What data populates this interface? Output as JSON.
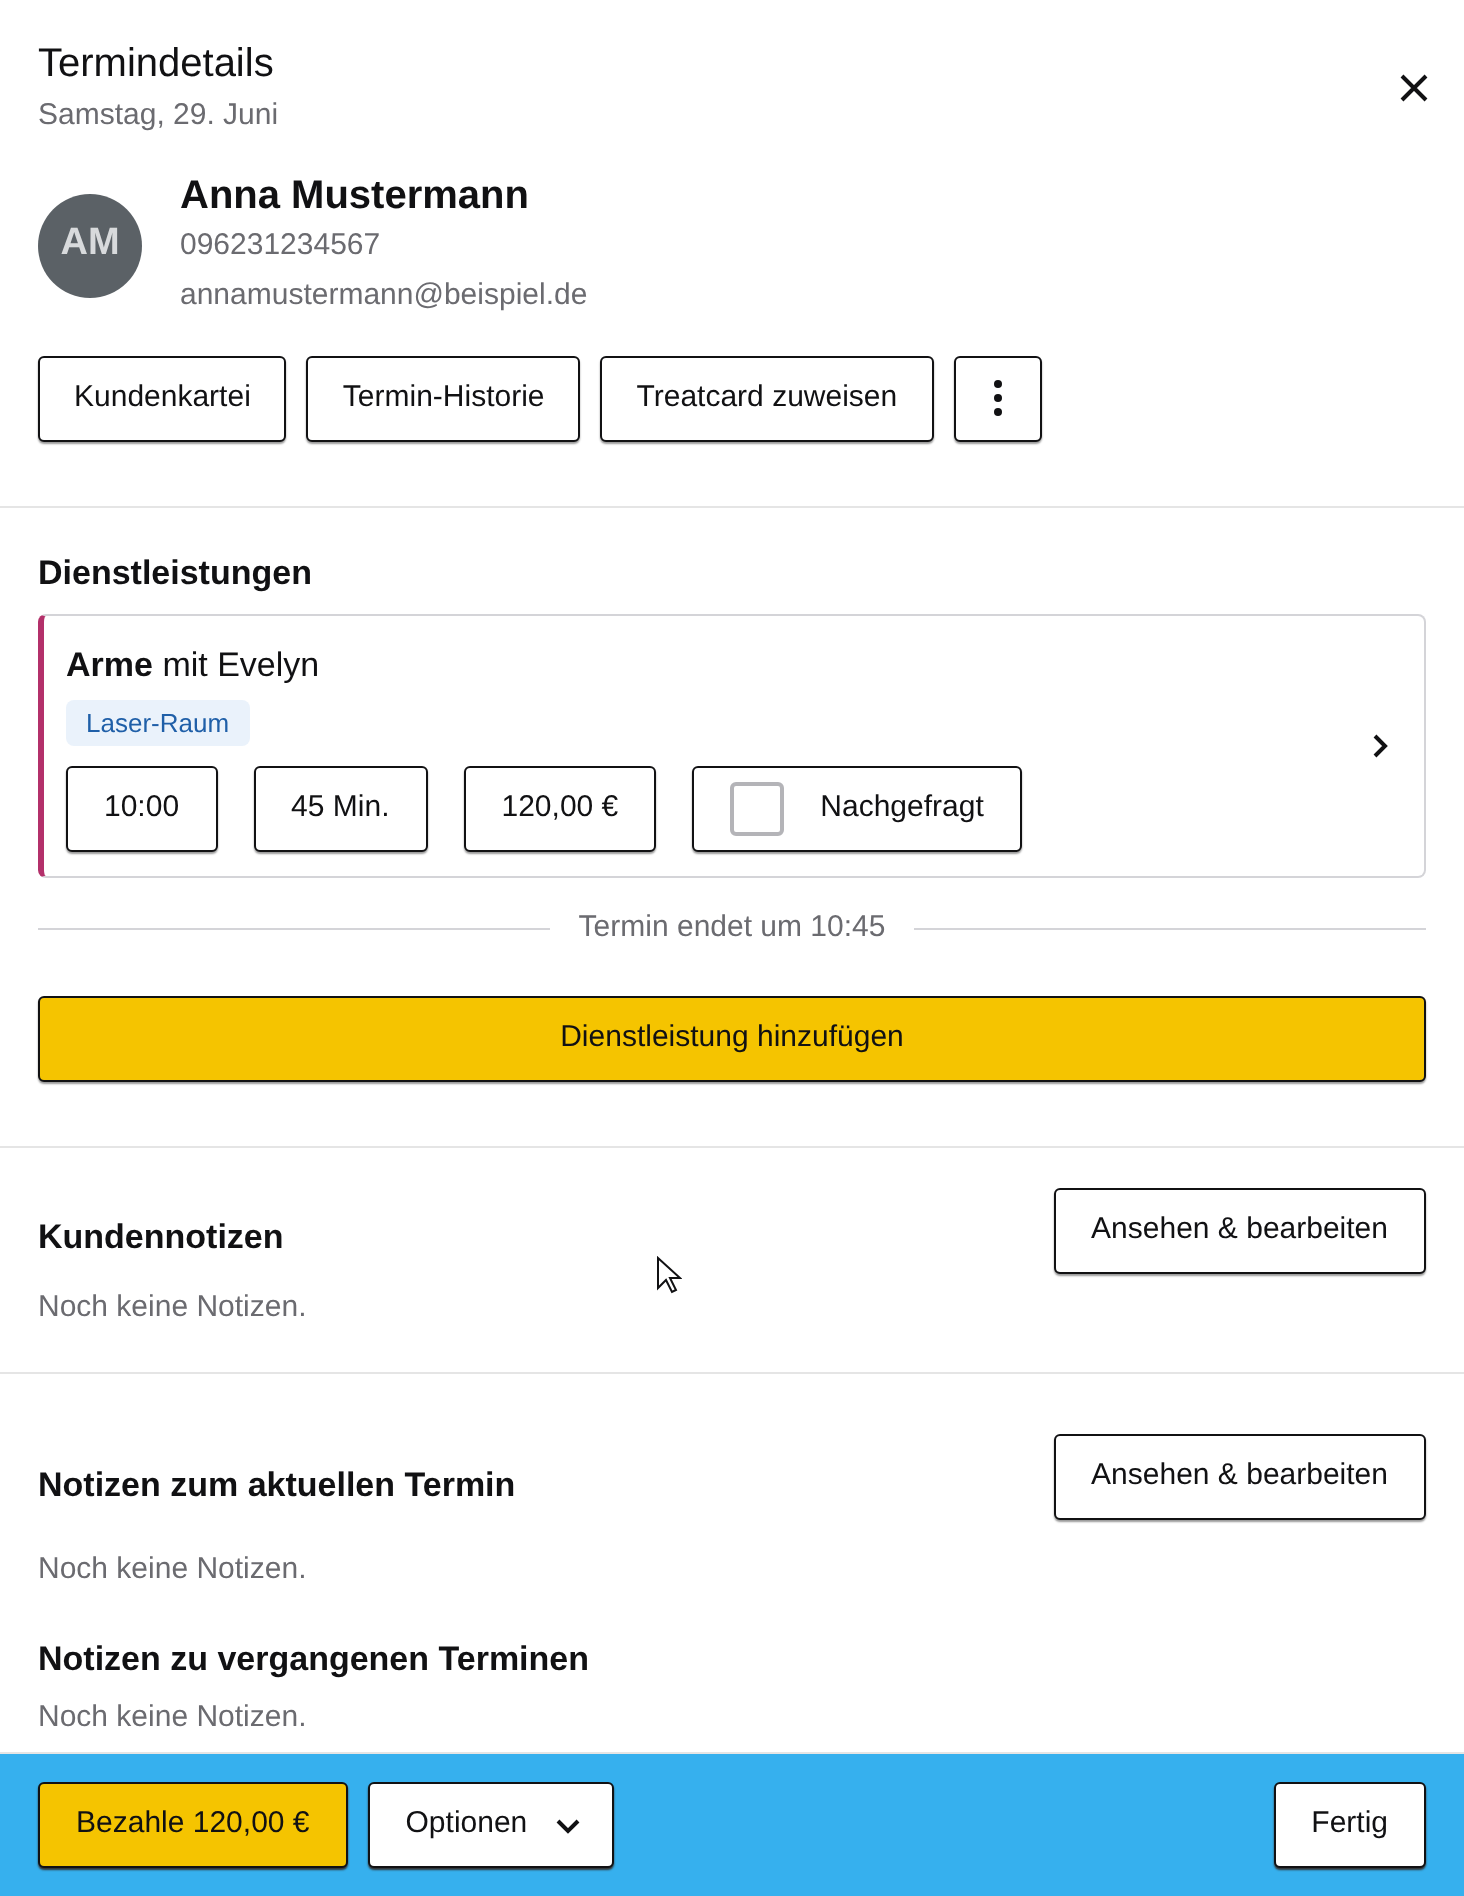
{
  "header": {
    "title": "Termindetails",
    "subtitle": "Samstag, 29. Juni"
  },
  "customer": {
    "initials": "AM",
    "name": "Anna Mustermann",
    "phone": "096231234567",
    "email": "annamustermann@beispiel.de"
  },
  "customer_actions": [
    "Kundenkartei",
    "Termin-Historie",
    "Treatcard zuweisen"
  ],
  "services": {
    "heading": "Dienstleistungen",
    "items": [
      {
        "title": "**Arme** mit Evelyn",
        "room": "Laser-Raum",
        "color": "#b3306a",
        "time": "10:00",
        "duration": "45 Min.",
        "price": "120,00 €",
        "requested_label": "Nachgefragt",
        "requested": false
      }
    ],
    "end_note": "Termin endet um 10:45",
    "add_button": "Dienstleistung hinzufügen"
  },
  "notes": [
    {
      "heading": "Kundennotizen",
      "button": "Ansehen & bearbeiten",
      "text": "Noch keine Notizen."
    },
    {
      "heading": "Notizen zum aktuellen Termin",
      "button": "Ansehen & bearbeiten",
      "text": "Noch keine Notizen."
    },
    {
      "heading": "Notizen zu vergangenen Terminen",
      "text": "Noch keine Notizen."
    }
  ],
  "footer": {
    "pay_button": "Bezahle 120,00 €",
    "options_button": "Optionen",
    "done_button": "Fertig"
  }
}
